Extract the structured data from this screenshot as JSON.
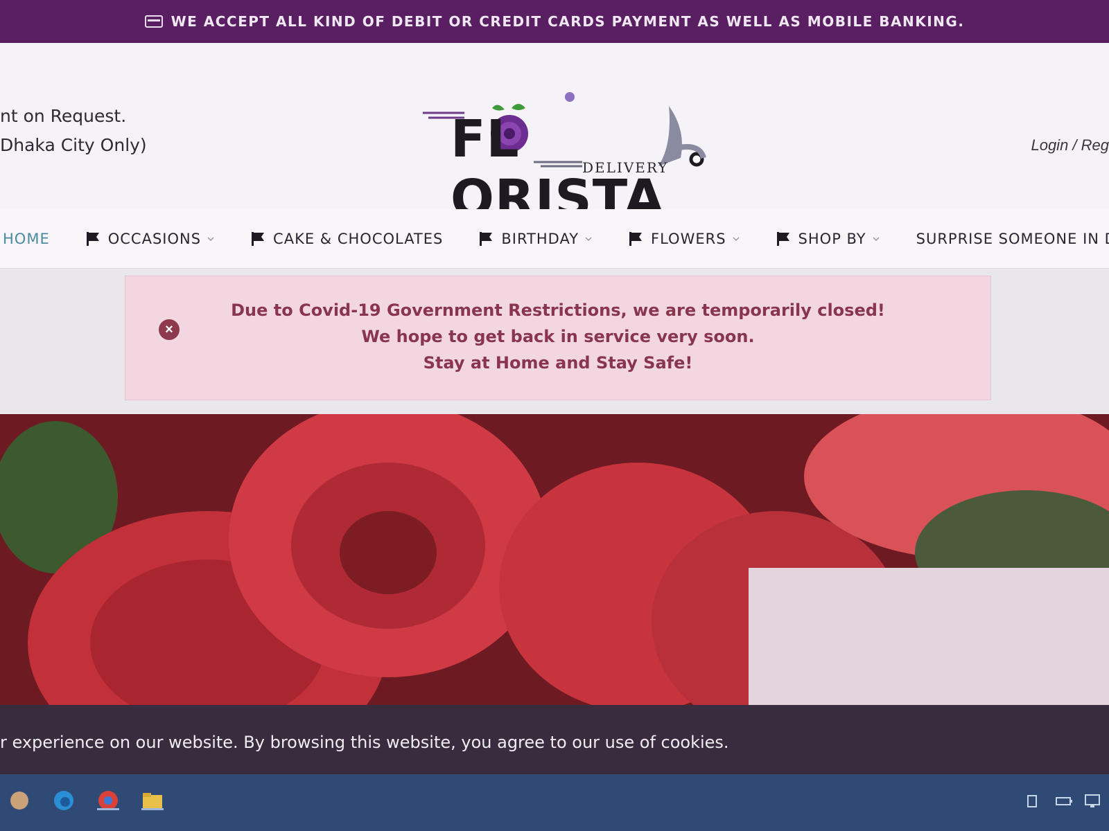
{
  "topbar": {
    "message": "WE ACCEPT ALL KIND OF DEBIT OR CREDIT CARDS PAYMENT AS WELL AS MOBILE BANKING.",
    "icon": "credit-card-icon"
  },
  "header": {
    "left_line1": "nt on Request.",
    "left_line2": "Dhaka City Only)",
    "login": "Login / Reg"
  },
  "logo": {
    "word": "FL ORISTA",
    "sub": "DELIVERY"
  },
  "nav": {
    "items": [
      {
        "label": "HOME"
      },
      {
        "label": "OCCASIONS"
      },
      {
        "label": "CAKE & CHOCOLATES"
      },
      {
        "label": "BIRTHDAY"
      },
      {
        "label": "FLOWERS"
      },
      {
        "label": "SHOP BY"
      },
      {
        "label": "SURPRISE SOMEONE IN DHAK"
      }
    ]
  },
  "alert": {
    "line1": "Due to Covid-19 Government Restrictions, we are temporarily closed!",
    "line2": "We hope to get back in service very soon.",
    "line3": "Stay at Home and Stay Safe!",
    "close_symbol": "×"
  },
  "cookie": {
    "text": "r experience on our website. By browsing this website, you agree to our use of cookies."
  },
  "colors": {
    "topbar": "#5a1f63",
    "nav_home": "#4b8aa0",
    "alert_bg": "#f2d7e1",
    "alert_text": "#8a3550",
    "cookie_bg": "#3a2c3f",
    "taskbar": "#2f4a74"
  }
}
